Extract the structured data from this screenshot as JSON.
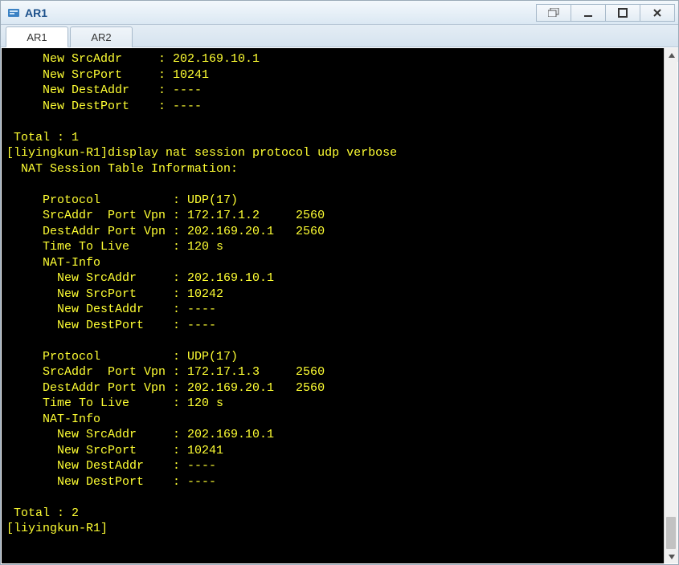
{
  "window": {
    "title": "AR1"
  },
  "tabs": [
    {
      "label": "AR1",
      "active": true
    },
    {
      "label": "AR2",
      "active": false
    }
  ],
  "prompt_host": "liyingkun-R1",
  "terminal": {
    "lines": [
      "     New SrcAddr     : 202.169.10.1",
      "     New SrcPort     : 10241",
      "     New DestAddr    : ----",
      "     New DestPort    : ----",
      "",
      " Total : 1",
      "[liyingkun-R1]display nat session protocol udp verbose",
      "  NAT Session Table Information:",
      "",
      "     Protocol          : UDP(17)",
      "     SrcAddr  Port Vpn : 172.17.1.2     2560",
      "     DestAddr Port Vpn : 202.169.20.1   2560",
      "     Time To Live      : 120 s",
      "     NAT-Info",
      "       New SrcAddr     : 202.169.10.1",
      "       New SrcPort     : 10242",
      "       New DestAddr    : ----",
      "       New DestPort    : ----",
      "",
      "     Protocol          : UDP(17)",
      "     SrcAddr  Port Vpn : 172.17.1.3     2560",
      "     DestAddr Port Vpn : 202.169.20.1   2560",
      "     Time To Live      : 120 s",
      "     NAT-Info",
      "       New SrcAddr     : 202.169.10.1",
      "       New SrcPort     : 10241",
      "       New DestAddr    : ----",
      "       New DestPort    : ----",
      "",
      " Total : 2",
      "[liyingkun-R1]"
    ]
  },
  "command": "display nat session protocol udp verbose",
  "nat_sessions_summary": {
    "previous_total": 1,
    "current_total": 2,
    "header": "NAT Session Table Information:",
    "sessions": [
      {
        "protocol": "UDP(17)",
        "src_addr": "172.17.1.2",
        "src_port": 2560,
        "dest_addr": "202.169.20.1",
        "dest_port": 2560,
        "ttl": "120 s",
        "nat_info": {
          "new_src_addr": "202.169.10.1",
          "new_src_port": 10242,
          "new_dest_addr": "----",
          "new_dest_port": "----"
        }
      },
      {
        "protocol": "UDP(17)",
        "src_addr": "172.17.1.3",
        "src_port": 2560,
        "dest_addr": "202.169.20.1",
        "dest_port": 2560,
        "ttl": "120 s",
        "nat_info": {
          "new_src_addr": "202.169.10.1",
          "new_src_port": 10241,
          "new_dest_addr": "----",
          "new_dest_port": "----"
        }
      }
    ]
  },
  "colors": {
    "terminal_bg": "#000000",
    "terminal_fg": "#ffff33",
    "title_fg": "#1a4f8a"
  }
}
